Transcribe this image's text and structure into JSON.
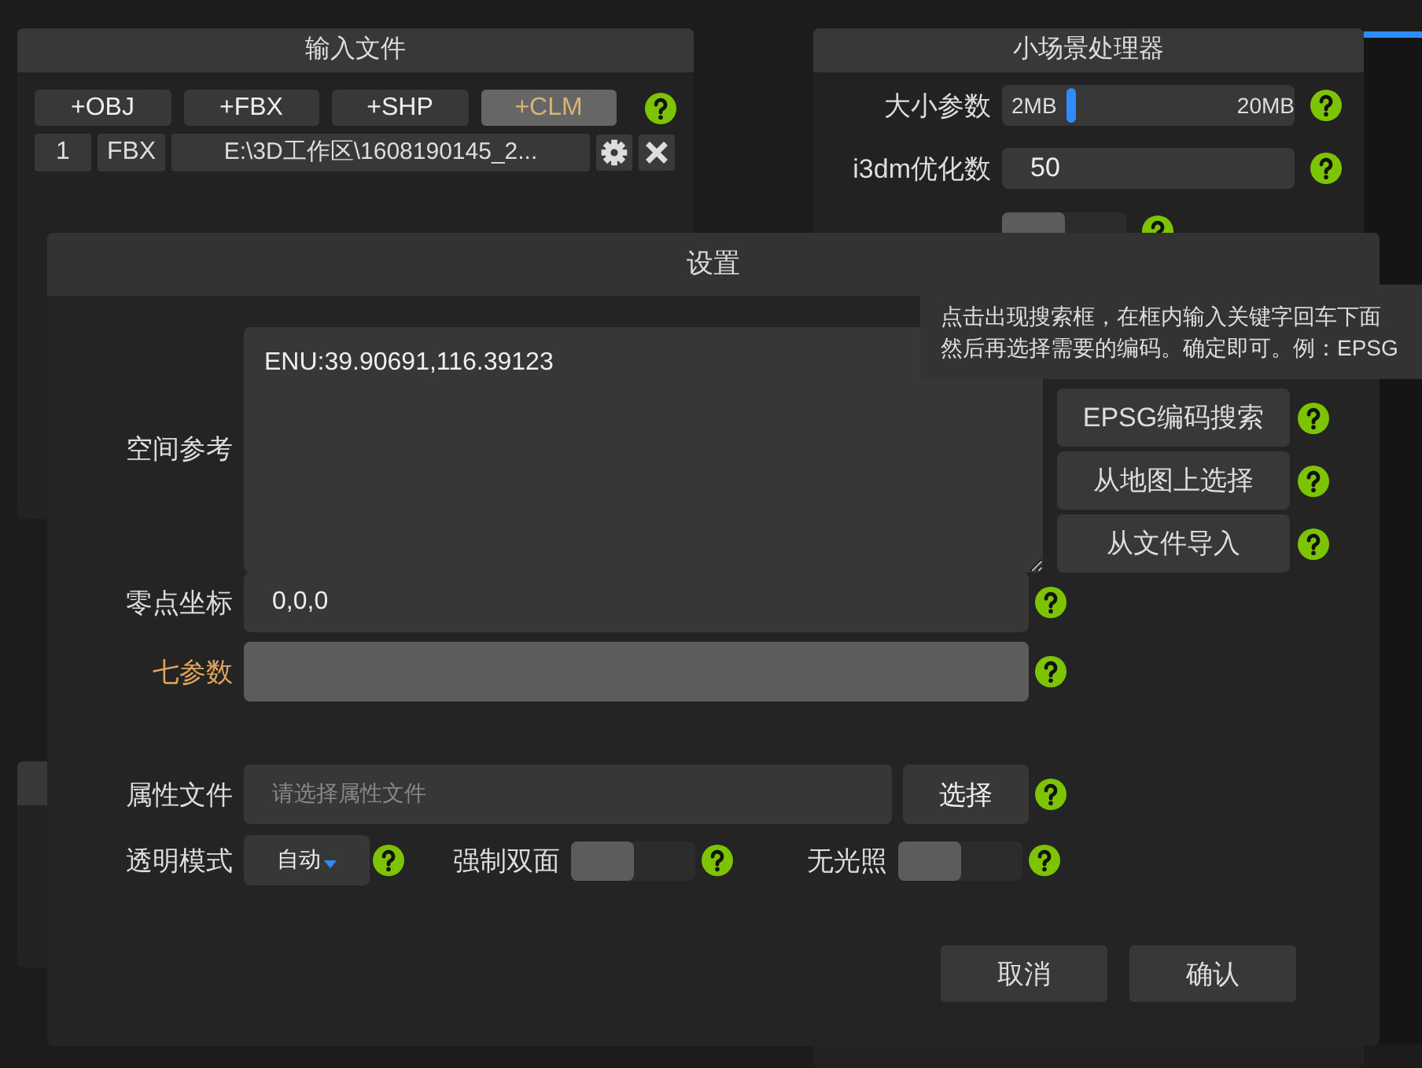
{
  "input_files_panel": {
    "title": "输入文件",
    "buttons": [
      {
        "label": "+OBJ",
        "selected": false
      },
      {
        "label": "+FBX",
        "selected": false
      },
      {
        "label": "+SHP",
        "selected": false
      },
      {
        "label": "+CLM",
        "selected": true
      }
    ],
    "file_row": {
      "index": "1",
      "type": "FBX",
      "path": "E:\\3D工作区\\1608190145_2..."
    }
  },
  "scene_processor_panel": {
    "title": "小场景处理器",
    "rows": [
      {
        "kind": "slider",
        "label": "大小参数",
        "min_label": "2MB",
        "max_label": "20MB",
        "level": 0.22
      },
      {
        "kind": "input",
        "label": "i3dm优化数",
        "value": "50"
      },
      {
        "kind": "toggle",
        "on": false
      }
    ]
  },
  "dialog": {
    "title": "设置",
    "spatial_reference": {
      "label": "空间参考",
      "value": "ENU:39.90691,116.39123"
    },
    "reference_buttons": [
      "EPSG编码搜索",
      "从地图上选择",
      "从文件导入"
    ],
    "tooltip": [
      "点击出现搜索框，在框内输入关键字回车下面",
      "然后再选择需要的编码。确定即可。例：EPSG"
    ],
    "origin": {
      "label": "零点坐标",
      "value": "0,0,0"
    },
    "seven_params": {
      "label": "七参数",
      "highlighted": true
    },
    "attribute_file": {
      "label": "属性文件",
      "placeholder": "请选择属性文件",
      "button": "选择"
    },
    "transparency": {
      "label": "透明模式",
      "value": "自动"
    },
    "toggles": [
      {
        "label": "强制双面",
        "on": false
      },
      {
        "label": "无光照",
        "on": false
      }
    ],
    "footer_buttons": [
      "取消",
      "确认"
    ]
  }
}
